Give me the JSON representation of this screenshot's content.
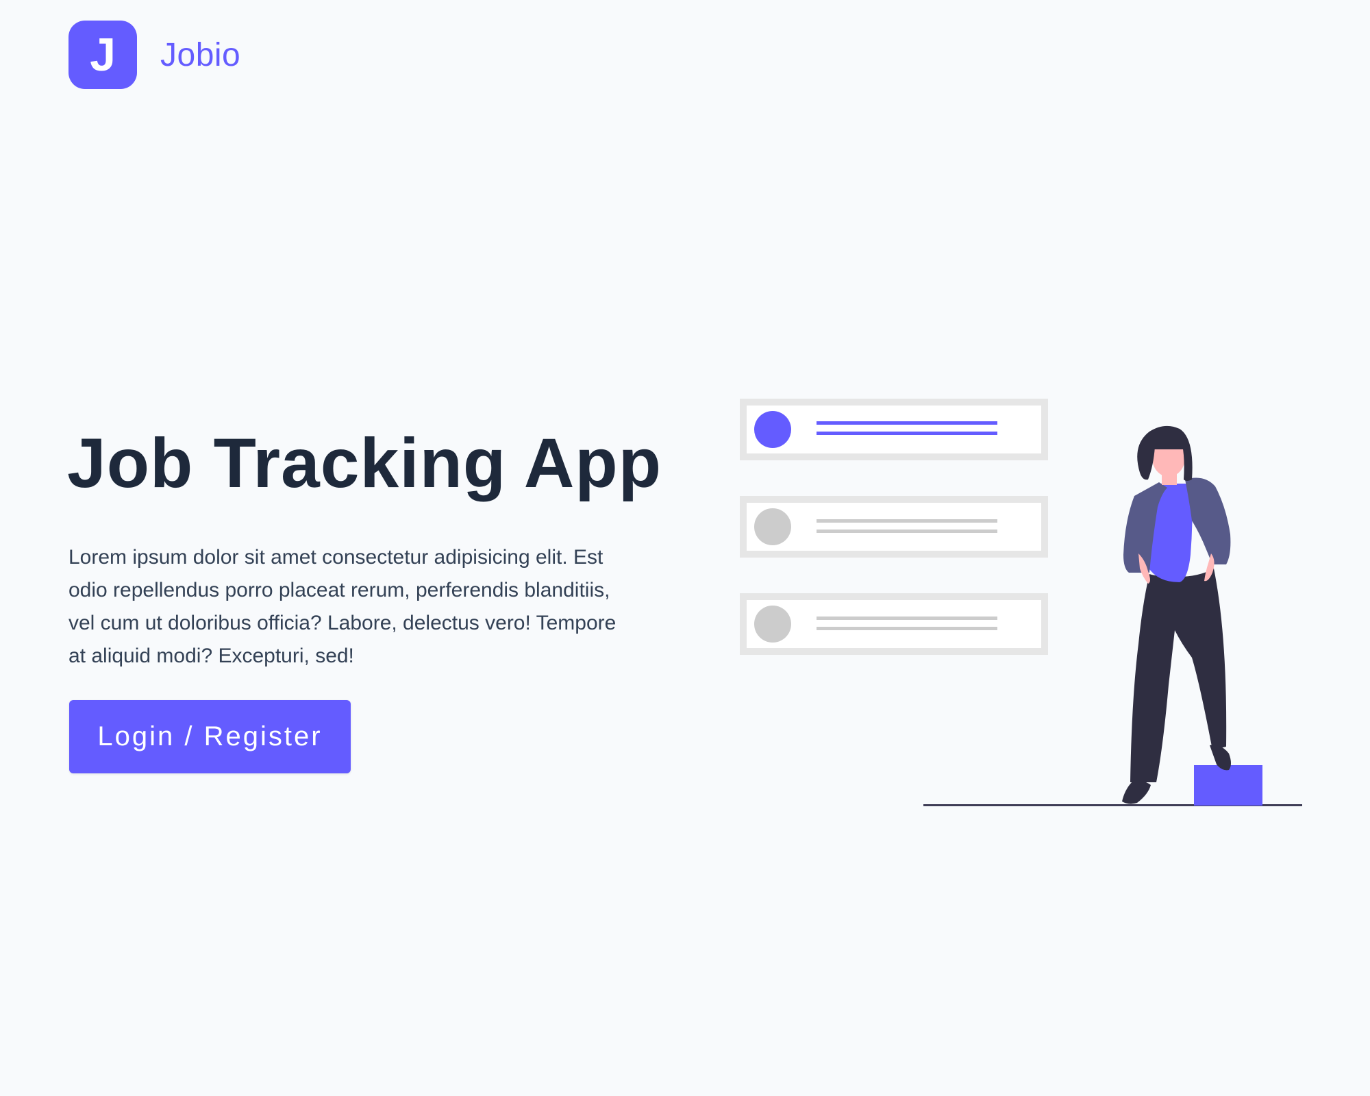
{
  "brand": {
    "logo_letter": "J",
    "name": "Jobio",
    "accent_color": "#645cff"
  },
  "hero": {
    "title": "Job Tracking App",
    "description": "Lorem ipsum dolor sit amet consectetur adipisicing elit. Est odio repellendus porro placeat rerum, perferendis blanditiis, vel cum ut doloribus officia? Labore, delectus vero! Tempore at aliquid modi? Excepturi, sed!",
    "cta_label": "Login / Register"
  },
  "illustration": {
    "name": "woman-with-job-list-illustration",
    "list_cards": [
      {
        "state": "active"
      },
      {
        "state": "inactive"
      },
      {
        "state": "inactive"
      }
    ]
  }
}
